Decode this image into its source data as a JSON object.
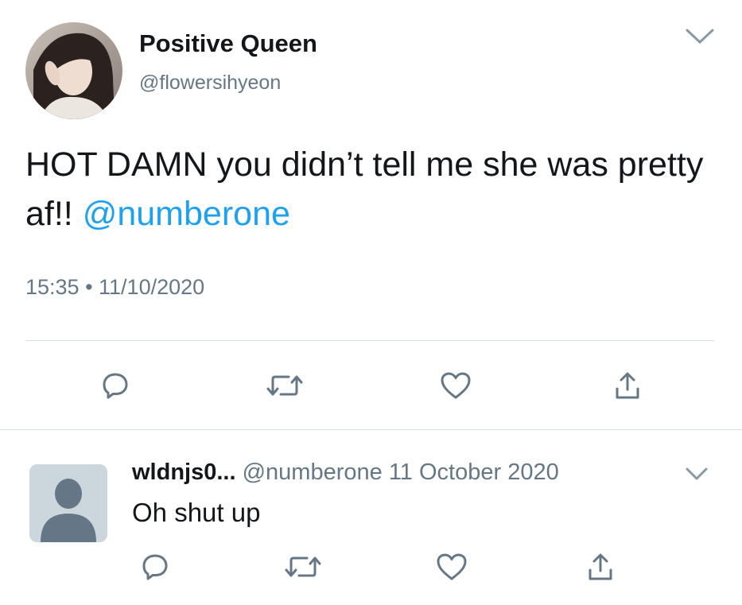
{
  "tweet": {
    "display_name": "Positive Queen",
    "handle": "@flowersihyeon",
    "text_before": "HOT DAMN you didn’t tell me she was pretty af!! ",
    "mention": "@numberone",
    "timestamp": "15:35 • 11/10/2020",
    "icons": [
      "reply-icon",
      "retweet-icon",
      "like-icon",
      "share-icon",
      "chevron-down-icon"
    ]
  },
  "reply": {
    "display_name": "wldnjs0...",
    "handle": "@numberone",
    "date": "11 October 2020",
    "text": "Oh shut up",
    "icons": [
      "reply-icon",
      "retweet-icon",
      "like-icon",
      "share-icon",
      "chevron-down-icon",
      "default-avatar-icon"
    ]
  },
  "colors": {
    "text": "#14171a",
    "secondary": "#657786",
    "link": "#1da1f2",
    "divider": "#d6dde2",
    "avatar_placeholder_bg": "#ccd6dd",
    "avatar_placeholder_fg": "#657786"
  }
}
